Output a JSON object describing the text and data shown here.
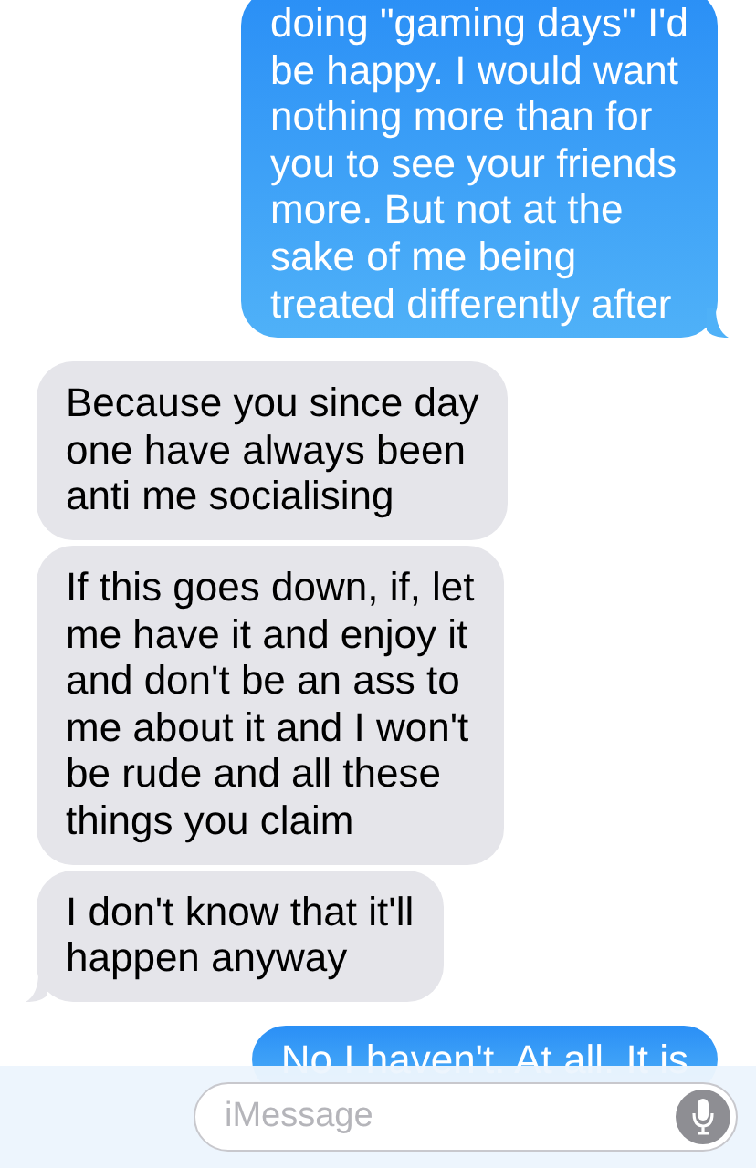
{
  "messages": [
    {
      "kind": "sent",
      "lines": [
        "doing \"gaming days\" I'd",
        "be happy. I would want",
        "nothing more than for",
        "you to see your friends",
        "more. But not at the",
        "sake of me being",
        "treated differently after"
      ]
    },
    {
      "kind": "received",
      "lines": [
        "Because you since day",
        "one have always been",
        "anti me socialising"
      ]
    },
    {
      "kind": "received",
      "lines": [
        "If this goes down, if, let",
        "me have it and enjoy it",
        "and don't be an ass to",
        "me about it and I won't",
        "be rude and all these",
        "things you claim"
      ]
    },
    {
      "kind": "received",
      "lines": [
        "I don't know that it'll",
        "happen anyway"
      ]
    },
    {
      "kind": "sent",
      "lines": [
        "No I haven't. At all. It is"
      ]
    }
  ],
  "compose": {
    "placeholder": "iMessage"
  }
}
